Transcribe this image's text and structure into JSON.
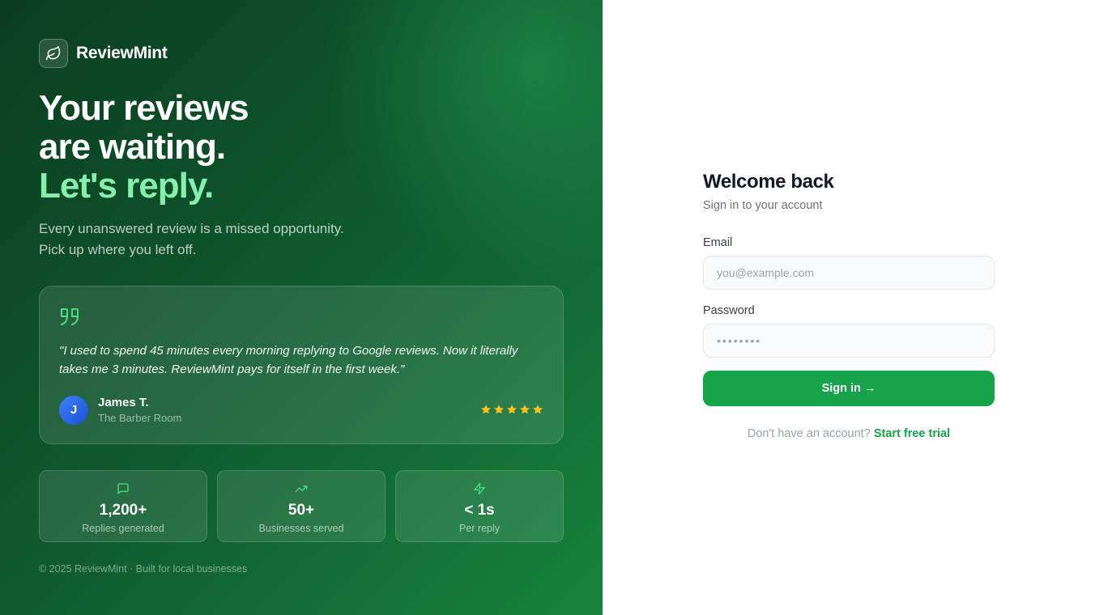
{
  "brand": {
    "name": "ReviewMint",
    "logo_icon": "leaf-icon"
  },
  "hero": {
    "line1": "Your reviews",
    "line2": "are waiting.",
    "accent": "Let's reply.",
    "sub_line1": "Every unanswered review is a missed opportunity.",
    "sub_line2": "Pick up where you left off.",
    "accent_color": "#86efac"
  },
  "testimonial": {
    "quote_icon": "quote-icon",
    "text": "\"I used to spend 45 minutes every morning replying to Google reviews. Now it literally takes me 3 minutes. ReviewMint pays for itself in the first week.\"",
    "author_initial": "J",
    "author_name": "James T.",
    "author_business": "The Barber Room",
    "rating": 5,
    "rating_max": 5
  },
  "stats": [
    {
      "icon": "message-square-icon",
      "value": "1,200+",
      "label": "Replies generated"
    },
    {
      "icon": "trending-up-icon",
      "value": "50+",
      "label": "Businesses served"
    },
    {
      "icon": "zap-icon",
      "value": "< 1s",
      "label": "Per reply"
    }
  ],
  "footer": "© 2025 ReviewMint · Built for local businesses",
  "login": {
    "title": "Welcome back",
    "subtitle": "Sign in to your account",
    "email_label": "Email",
    "email_placeholder": "you@example.com",
    "password_label": "Password",
    "password_value": "••••••••",
    "submit_label": "Sign in →",
    "signup_prompt": "Don't have an account?",
    "signup_link": "Start free trial",
    "accent_color": "#16a34a"
  }
}
